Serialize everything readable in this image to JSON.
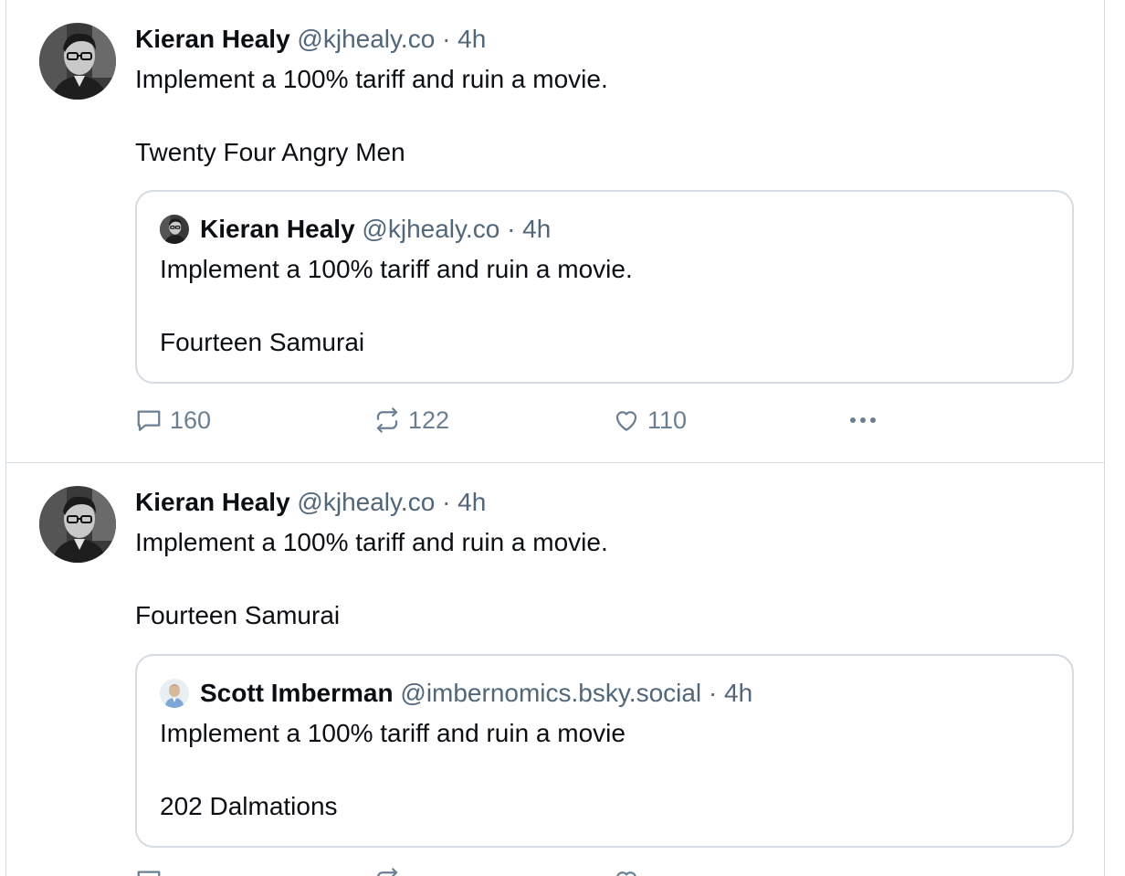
{
  "posts": [
    {
      "author": "Kieran Healy",
      "handle": "@kjhealy.co",
      "separator": "·",
      "time": "4h",
      "text_line1": "Implement a 100% tariff and ruin a movie.",
      "text_line2": "Twenty Four Angry Men",
      "quote": {
        "author": "Kieran Healy",
        "handle": "@kjhealy.co",
        "separator": "·",
        "time": "4h",
        "text_line1": "Implement a 100% tariff and ruin a movie.",
        "text_line2": "Fourteen Samurai"
      },
      "actions": {
        "replies": "160",
        "reposts": "122",
        "likes": "110"
      }
    },
    {
      "author": "Kieran Healy",
      "handle": "@kjhealy.co",
      "separator": "·",
      "time": "4h",
      "text_line1": "Implement a 100% tariff and ruin a movie.",
      "text_line2": "Fourteen Samurai",
      "quote": {
        "author": "Scott Imberman",
        "handle": "@imbernomics.bsky.social",
        "separator": "·",
        "time": "4h",
        "text_line1": "Implement a 100% tariff and ruin a movie",
        "text_line2": "202 Dalmations"
      },
      "actions": {
        "replies": "",
        "reposts": "",
        "likes": ""
      }
    }
  ],
  "icons": {
    "reply": "speech-bubble-icon",
    "repost": "repost-arrows-icon",
    "like": "heart-icon",
    "more": "ellipsis-icon"
  },
  "colors": {
    "muted": "#52667a",
    "action": "#6b7f92",
    "border": "#d4dbe2"
  }
}
